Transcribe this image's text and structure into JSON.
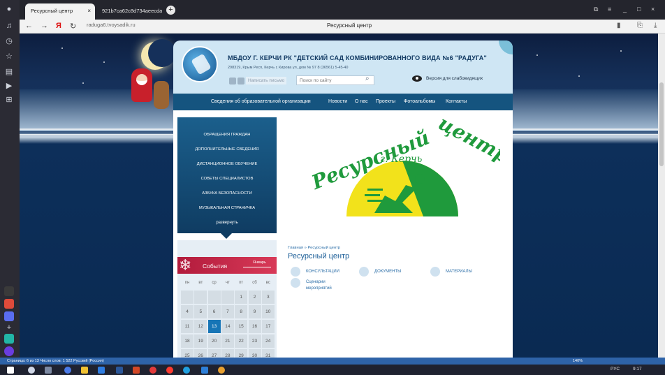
{
  "browser": {
    "tabs": [
      {
        "label": "Ресурсный центр",
        "active": true
      },
      {
        "label": "921b7ca62c8d734aeecda",
        "active": false
      }
    ],
    "url": "raduga6.tvoysadik.ru",
    "page_title": "Ресурсный центр"
  },
  "site": {
    "title": "МБДОУ Г. КЕРЧИ РК \"ДЕТСКИЙ САД КОМБИНИРОВАННОГО ВИДА №6 \"РАДУГА\"",
    "address": "298319, Крым Респ, Керчь г, Кирова ул, дом № 97   8 (36561) 5-45-40",
    "write_link": "Написать письмо",
    "search_placeholder": "Поиск по сайту",
    "accessible_version": "Версия для слабовидящих",
    "nav": [
      "Сведения об образовательной организации",
      "Новости",
      "О нас",
      "Проекты",
      "Фотоальбомы",
      "Контакты"
    ]
  },
  "sidemenu": {
    "items": [
      "Обращения граждан",
      "Дополнительные сведения",
      "Дистанционное обучение",
      "Советы специалистов",
      "Азбука безопасности",
      "Музыкальная страничка"
    ],
    "expand": "развернуть"
  },
  "events": {
    "title": "События",
    "month": "Январь",
    "weekdays": [
      "пн",
      "вт",
      "ср",
      "чт",
      "пт",
      "сб",
      "вс"
    ],
    "rows": [
      [
        "",
        "",
        "",
        "",
        "1",
        "2",
        "3"
      ],
      [
        "4",
        "5",
        "6",
        "7",
        "8",
        "9",
        "10"
      ],
      [
        "11",
        "12",
        "13",
        "14",
        "15",
        "16",
        "17"
      ],
      [
        "18",
        "19",
        "20",
        "21",
        "22",
        "23",
        "24"
      ],
      [
        "25",
        "26",
        "27",
        "28",
        "29",
        "30",
        "31"
      ]
    ],
    "today": "13"
  },
  "logo": {
    "word1": "Ресурсный",
    "word2": "центр",
    "city": "г. Керчь"
  },
  "main": {
    "breadcrumb": "Главная » Ресурсный центр",
    "heading": "Ресурсный центр",
    "categories": [
      "КОНСУЛЬТАЦИИ",
      "ДОКУМЕНТЫ",
      "МАТЕРИАЛЫ"
    ],
    "category_extra_line1": "Сценарии",
    "category_extra_line2": "мероприятий"
  },
  "statusbar": {
    "left": "Страница: 6 из 13   Число слов: 1 522   Русский (Россия)",
    "zoom": "140%"
  },
  "taskbar": {
    "lang": "РУС",
    "time": "9:17"
  },
  "colors": {
    "accent": "#15547f",
    "events": "#c42a4a",
    "today": "#1675b6",
    "logo_green": "#1f9a3c",
    "logo_yellow": "#f2e21b"
  }
}
